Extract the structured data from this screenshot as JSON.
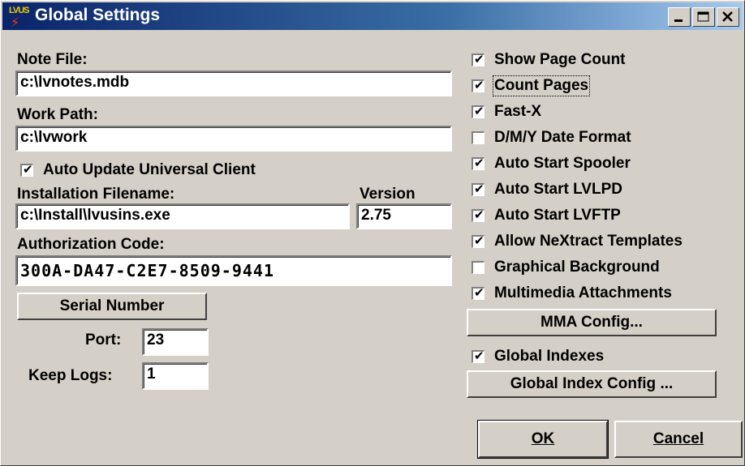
{
  "window": {
    "title": "Global Settings",
    "icon_text": "LVUS",
    "icon": "lvus-app-icon",
    "title_gradient": [
      "#0a246a",
      "#a6caf0"
    ],
    "controls": [
      "minimize-icon",
      "maximize-icon",
      "close-icon"
    ]
  },
  "left": {
    "note_file_label": "Note File:",
    "note_file_value": "c:\\lvnotes.mdb",
    "work_path_label": "Work Path:",
    "work_path_value": "c:\\lvwork",
    "auto_update": {
      "label": "Auto Update Universal Client",
      "checked": true
    },
    "install_filename_label": "Installation Filename:",
    "install_filename_value": "c:\\Install\\lvusins.exe",
    "version_label": "Version",
    "version_value": "2.75",
    "auth_code_label": "Authorization Code:",
    "auth_code_value": "300A-DA47-C2E7-8509-9441",
    "serial_button": "Serial Number",
    "port_label": "Port:",
    "port_value": "23",
    "keep_logs_label": "Keep Logs:",
    "keep_logs_value": "1"
  },
  "right": {
    "options": [
      {
        "label": "Show Page Count",
        "checked": true
      },
      {
        "label": "Count Pages",
        "checked": true,
        "focused": true
      },
      {
        "label": "Fast-X",
        "checked": true
      },
      {
        "label": "D/M/Y Date Format",
        "checked": false
      },
      {
        "label": "Auto Start Spooler",
        "checked": true
      },
      {
        "label": "Auto Start LVLPD",
        "checked": true
      },
      {
        "label": "Auto Start LVFTP",
        "checked": true
      },
      {
        "label": "Allow NeXtract Templates",
        "checked": true
      },
      {
        "label": "Graphical Background",
        "checked": false
      },
      {
        "label": "Multimedia Attachments",
        "checked": true
      }
    ],
    "mma_button": "MMA Config...",
    "global_indexes": {
      "label": "Global Indexes",
      "checked": true
    },
    "global_index_button": "Global Index Config ..."
  },
  "footer": {
    "ok_label": "OK",
    "cancel_label": "Cancel"
  }
}
